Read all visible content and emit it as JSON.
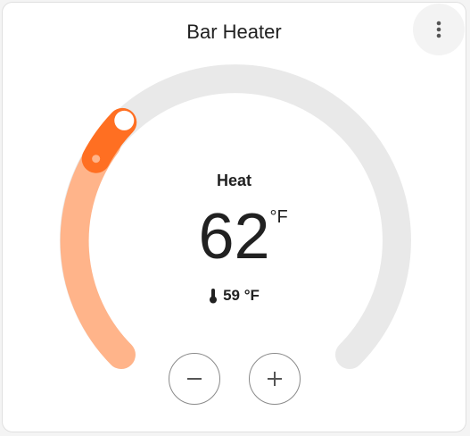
{
  "card": {
    "title": "Bar Heater",
    "menu_icon": "dots-vertical-icon"
  },
  "thermostat": {
    "mode_label": "Heat",
    "target_temp": "62",
    "target_unit": "°F",
    "current_temp_label": "59 °F",
    "current_temp_icon": "thermometer-icon",
    "decrease_icon": "minus-icon",
    "increase_icon": "plus-icon"
  },
  "colors": {
    "track": "#e9e9e9",
    "heat_range": "#ffb48a",
    "heat_accent": "#ff6f22",
    "text": "#212121"
  }
}
